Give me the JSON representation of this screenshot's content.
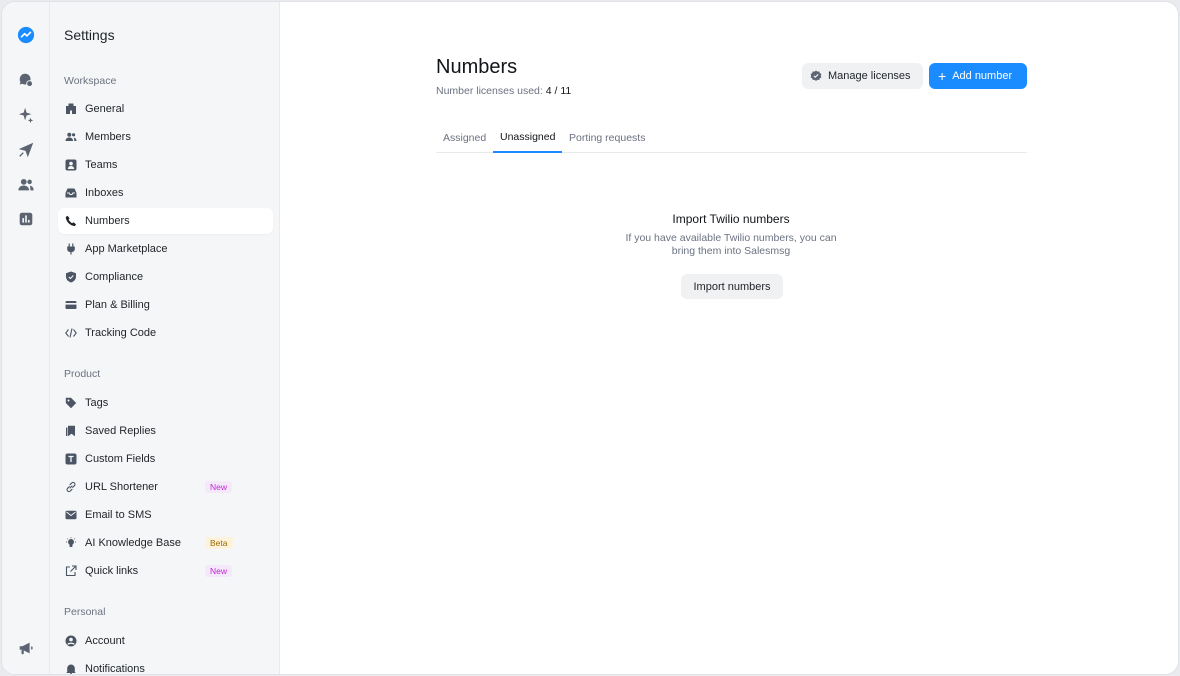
{
  "colors": {
    "accent": "#1a8cff",
    "new_badge": "#c026d3",
    "beta_badge": "#9a6a00"
  },
  "rail": {
    "items": [
      {
        "icon": "logo-icon"
      },
      {
        "icon": "chat-icon"
      },
      {
        "icon": "sparkle-icon"
      },
      {
        "icon": "send-icon"
      },
      {
        "icon": "contacts-icon"
      },
      {
        "icon": "reports-icon"
      },
      {
        "icon": "megaphone-icon"
      }
    ]
  },
  "sidebar": {
    "title": "Settings",
    "groups": {
      "workspace": {
        "label": "Workspace",
        "items": [
          {
            "label": "General",
            "icon": "building-icon"
          },
          {
            "label": "Members",
            "icon": "members-icon"
          },
          {
            "label": "Teams",
            "icon": "teams-icon"
          },
          {
            "label": "Inboxes",
            "icon": "inbox-icon"
          },
          {
            "label": "Numbers",
            "icon": "phone-icon",
            "active": true
          },
          {
            "label": "App Marketplace",
            "icon": "plug-icon"
          },
          {
            "label": "Compliance",
            "icon": "shield-icon"
          },
          {
            "label": "Plan & Billing",
            "icon": "card-icon"
          },
          {
            "label": "Tracking Code",
            "icon": "code-icon"
          }
        ]
      },
      "product": {
        "label": "Product",
        "items": [
          {
            "label": "Tags",
            "icon": "tag-icon"
          },
          {
            "label": "Saved Replies",
            "icon": "saved-replies-icon"
          },
          {
            "label": "Custom Fields",
            "icon": "text-field-icon"
          },
          {
            "label": "URL Shortener",
            "icon": "link-icon",
            "badge": "New"
          },
          {
            "label": "Email to SMS",
            "icon": "mail-icon"
          },
          {
            "label": "AI Knowledge Base",
            "icon": "bulb-icon",
            "badge": "Beta"
          },
          {
            "label": "Quick links",
            "icon": "external-link-icon",
            "badge": "New"
          }
        ]
      },
      "personal": {
        "label": "Personal",
        "items": [
          {
            "label": "Account",
            "icon": "account-icon"
          },
          {
            "label": "Notifications",
            "icon": "bell-icon"
          }
        ]
      }
    }
  },
  "main": {
    "title": "Numbers",
    "licenses_label": "Number licenses used:",
    "licenses_used": "4",
    "licenses_sep": "/",
    "licenses_total": "11",
    "manage_licenses_label": "Manage licenses",
    "add_number_label": "Add number",
    "tabs": [
      {
        "label": "Assigned"
      },
      {
        "label": "Unassigned",
        "active": true
      },
      {
        "label": "Porting requests"
      }
    ],
    "empty": {
      "title": "Import Twilio numbers",
      "desc_line1": "If you have available Twilio numbers, you can",
      "desc_line2": "bring them into Salesmsg",
      "import_label": "Import numbers"
    }
  }
}
